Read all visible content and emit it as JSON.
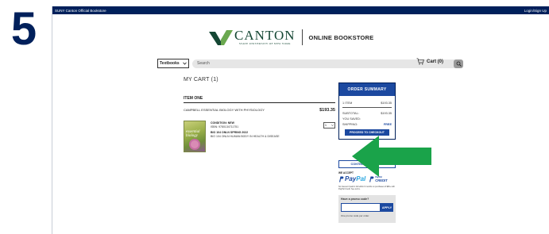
{
  "step": {
    "number": "5"
  },
  "topbar": {
    "left_text": "SUNY Canton Official Bookstore",
    "right_text": "Login/Sign Up"
  },
  "brand": {
    "name": "CANTON",
    "tagline": "STATE UNIVERSITY OF NEW YORK",
    "store_label": "ONLINE BOOKSTORE"
  },
  "search": {
    "category": "Textbooks",
    "placeholder": "Search"
  },
  "cart": {
    "label": "Cart (0)"
  },
  "page": {
    "title": "MY CART (1)"
  },
  "item": {
    "heading": "ITEM ONE",
    "title": "CAMPBELL ESSENTIAL BIOLOGY WITH PHYSIOLOGY",
    "price": "$193.35",
    "quantity": "1",
    "condition": "CONDITION: NEW",
    "isbn": "ISBN: 9780134711751",
    "course": "BIO 104 ONLN SPRING 2022",
    "course_desc": "BIO 104 ONLN HUMAN BODY IN HEALTH & DISEASE",
    "cover_word": "essential biology"
  },
  "summary": {
    "header": "ORDER SUMMARY",
    "items_label": "1 ITEM",
    "items_value": "$193.35",
    "subtotal_label": "SUBTOTAL:",
    "subtotal_value": "$193.35",
    "saved_label": "YOU SAVED:",
    "saved_value": "",
    "shipping_label": "SHIPPING:",
    "shipping_value": "FREE",
    "checkout_label": "PROCEED TO CHECKOUT"
  },
  "continue_label": "CONTINUE SHOPPING",
  "payment": {
    "we_accept": "WE ACCEPT",
    "paypal_a": "Pay",
    "paypal_b": "Pal",
    "credit_top": "PayPal",
    "credit_bottom": "CREDIT",
    "note": "No Interest if paid in full within 6 months on purchases of $99+ with PayPal Credit. See terms."
  },
  "promo": {
    "title": "Have a promo code?",
    "apply_label": "APPLY",
    "note": "One promo code per order."
  },
  "colors": {
    "navy": "#00205b",
    "blue": "#1c49a0",
    "green": "#1aa34a",
    "canton_green": "#154734"
  },
  "icons": {
    "arrow": "right-pointing-arrow-icon",
    "cart": "cart-icon",
    "search": "search-icon"
  }
}
